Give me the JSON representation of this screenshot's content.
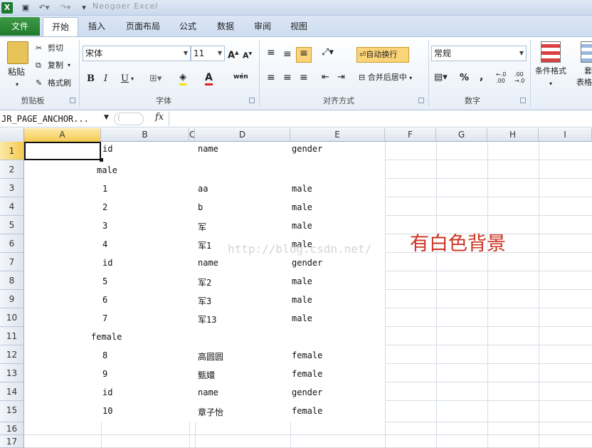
{
  "window": {
    "title": "Neogoer Excel"
  },
  "tabs": [
    {
      "label": "文件"
    },
    {
      "label": "开始"
    },
    {
      "label": "插入"
    },
    {
      "label": "页面布局"
    },
    {
      "label": "公式"
    },
    {
      "label": "数据"
    },
    {
      "label": "审阅"
    },
    {
      "label": "视图"
    }
  ],
  "ribbon": {
    "clipboard": {
      "paste": "粘贴",
      "cut": "剪切",
      "copy": "复制",
      "painter": "格式刷",
      "group": "剪贴板"
    },
    "font": {
      "name": "宋体",
      "size": "11",
      "bold": "B",
      "italic": "I",
      "underline": "U",
      "fontcolor": "A",
      "wen": "wén",
      "group": "字体"
    },
    "align": {
      "wrap": "自动换行",
      "merge": "合并后居中",
      "group": "对齐方式"
    },
    "number": {
      "format": "常规",
      "percent": "%",
      "comma": ",",
      "inc": "←.0\n.00",
      "dec": ".00\n→.0",
      "group": "数字"
    },
    "styles": {
      "cond": "条件格式",
      "table": "套\n表格"
    }
  },
  "formula": {
    "namebox": "JR_PAGE_ANCHOR...",
    "fx": "fx",
    "value": ""
  },
  "columns": [
    "A",
    "B",
    "C",
    "D",
    "E",
    "F",
    "G",
    "H",
    "I"
  ],
  "rows": [
    "1",
    "2",
    "3",
    "4",
    "5",
    "6",
    "7",
    "8",
    "9",
    "10",
    "11",
    "12",
    "13",
    "14",
    "15",
    "16",
    "17"
  ],
  "cells": [
    {
      "b": "id",
      "d": "name",
      "e": "gender"
    },
    {
      "a": "male"
    },
    {
      "b": "1",
      "d": "aa",
      "e": "male"
    },
    {
      "b": "2",
      "d": "b",
      "e": "male"
    },
    {
      "b": "3",
      "d": "军",
      "e": "male"
    },
    {
      "b": "4",
      "d": "军1",
      "e": "male"
    },
    {
      "b": "id",
      "d": "name",
      "e": "gender"
    },
    {
      "b": "5",
      "d": "军2",
      "e": "male"
    },
    {
      "b": "6",
      "d": "军3",
      "e": "male"
    },
    {
      "b": "7",
      "d": "军13",
      "e": "male"
    },
    {
      "a": "female"
    },
    {
      "b": "8",
      "d": "高圆圆",
      "e": "female"
    },
    {
      "b": "9",
      "d": "甄嬛",
      "e": "female"
    },
    {
      "b": "id",
      "d": "name",
      "e": "gender"
    },
    {
      "b": "10",
      "d": "章子怡",
      "e": "female"
    }
  ],
  "watermark": "http://blog.csdn.net/",
  "annotation": "有白色背景"
}
